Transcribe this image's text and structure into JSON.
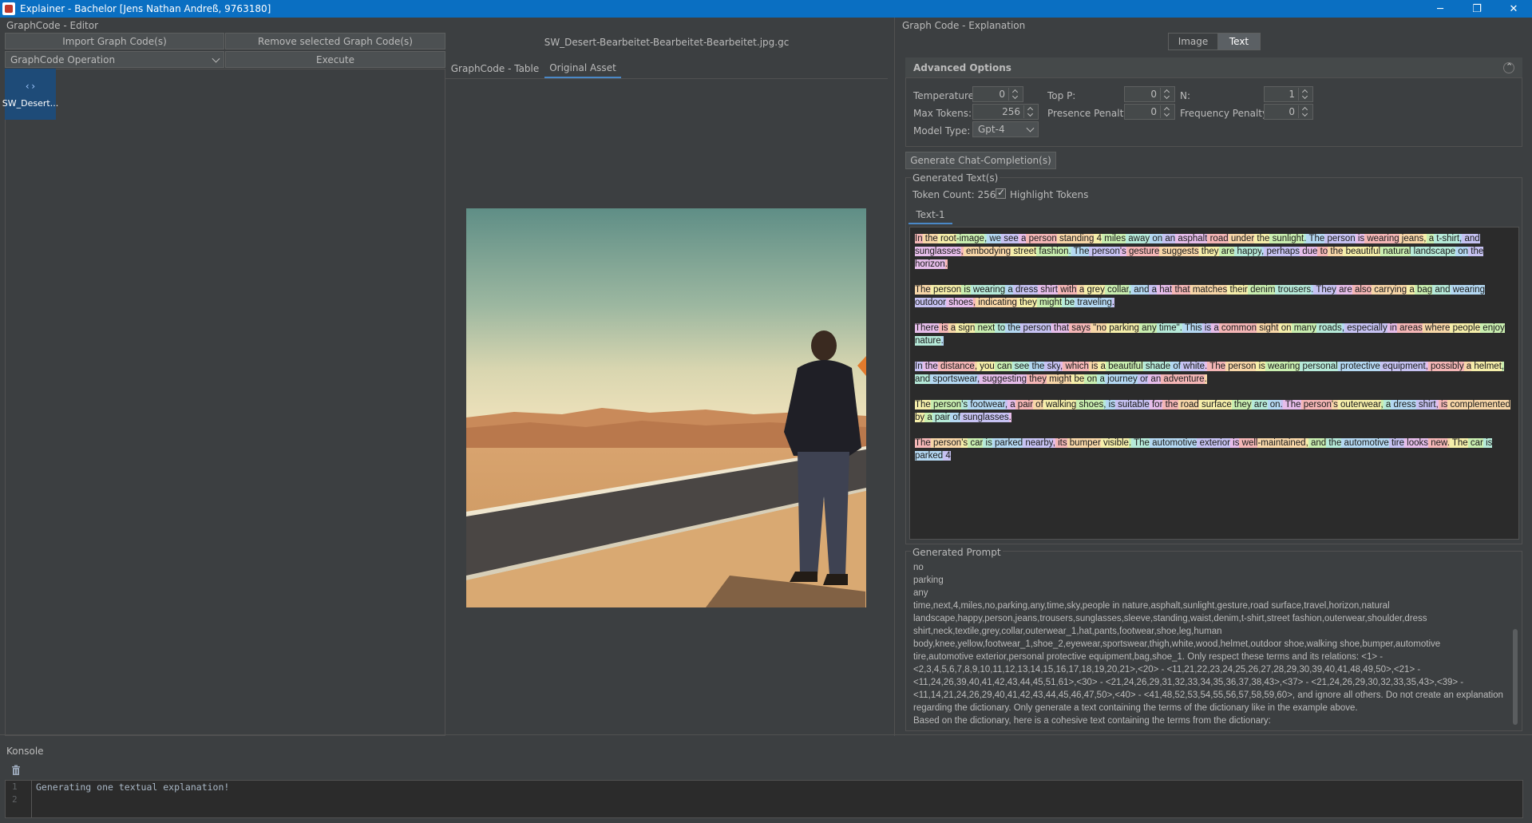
{
  "window": {
    "title": "Explainer - Bachelor [Jens Nathan Andreß, 9763180]"
  },
  "editor": {
    "panel_title": "GraphCode - Editor",
    "import_label": "Import Graph Code(s)",
    "remove_label": "Remove selected Graph Code(s)",
    "operation_selected": "GraphCode Operation",
    "execute_label": "Execute",
    "item_label": "SW_Desert..."
  },
  "viewer": {
    "filename": "SW_Desert-Bearbeitet-Bearbeitet-Bearbeitet.jpg.gc",
    "tabs": [
      "GraphCode - Table",
      "Original Asset"
    ],
    "active_tab": "Original Asset"
  },
  "explanation": {
    "panel_title": "Graph Code - Explanation",
    "mode_buttons": [
      "Image",
      "Text"
    ],
    "mode_selected": "Text",
    "advanced": {
      "title": "Advanced Options",
      "temperature_label": "Temperature:",
      "temperature": "0",
      "top_p_label": "Top P:",
      "top_p": "0",
      "n_label": "N:",
      "n": "1",
      "max_tokens_label": "Max Tokens:",
      "max_tokens": "256",
      "presence_label": "Presence Penalty:",
      "presence": "0",
      "frequency_label": "Frequency Penalty:",
      "frequency": "0",
      "model_label": "Model Type:",
      "model": "Gpt-4"
    },
    "generate_label": "Generate Chat-Completion(s)",
    "generated_texts_title": "Generated Text(s)",
    "token_count": "Token Count: 256",
    "highlight_label": "Highlight Tokens",
    "text_tab": "Text-1",
    "paragraphs": [
      [
        "In",
        " the",
        " root",
        "-image",
        ",",
        " we",
        " see",
        " a",
        " person",
        " standing",
        " 4",
        " miles",
        " away",
        " on",
        " an",
        " asphalt",
        " road",
        " under",
        " the",
        " sunlight",
        ".",
        " The",
        " person",
        " is",
        " wearing",
        " jeans",
        ",",
        " a",
        " t-shirt",
        ",",
        " and",
        " sunglasses",
        ",",
        " embodying",
        " street",
        " fashion",
        ".",
        " The",
        " person",
        "'s",
        " gesture",
        " suggests",
        " they",
        " are",
        " happy",
        ",",
        " perhaps",
        " due",
        " to",
        " the",
        " beautiful",
        " natural",
        " landscape",
        " on",
        " the",
        " horizon",
        "."
      ],
      [
        "The",
        " person",
        " is",
        " wearing",
        " a",
        " dress",
        " shirt",
        " with",
        " a",
        " grey",
        " collar",
        ",",
        " and",
        " a",
        " hat",
        " that",
        " matches",
        " their",
        " denim",
        " trousers",
        ".",
        " They",
        " are",
        " also",
        " carrying",
        " a",
        " bag",
        " and",
        " wearing",
        " outdoor",
        " shoes",
        ",",
        " indicating",
        " they",
        " might",
        " be",
        " traveling",
        "."
      ],
      [
        "There",
        " is",
        " a",
        " sign",
        " next",
        " to",
        " the",
        " person",
        " that",
        " says",
        " \"no",
        " parking",
        " any",
        " time\".",
        " This",
        " is",
        " a",
        " common",
        " sight",
        " on",
        " many",
        " roads",
        ",",
        " especially",
        " in",
        " areas",
        " where",
        " people",
        " enjoy",
        " nature",
        "."
      ],
      [
        "In",
        " the",
        " distance",
        ",",
        " you",
        " can",
        " see",
        " the",
        " sky",
        ",",
        " which",
        " is",
        " a",
        " beautiful",
        " shade",
        " of",
        " white",
        ".",
        " The",
        " person",
        " is",
        " wearing",
        " personal",
        " protective",
        " equipment",
        ",",
        " possibly",
        " a",
        " helmet",
        ",",
        " and",
        " sportswear",
        ",",
        " suggesting",
        " they",
        " might",
        " be",
        " on",
        " a",
        " journey",
        " or",
        " an",
        " adventure",
        "."
      ],
      [
        "The",
        " person",
        "'s",
        " footwear",
        ",",
        " a",
        " pair",
        " of",
        " walking",
        " shoes",
        ",",
        " is",
        " suitable",
        " for",
        " the",
        " road",
        " surface",
        " they",
        " are",
        " on",
        ".",
        " The",
        " person",
        "'s",
        " outerwear",
        ",",
        " a",
        " dress",
        " shirt",
        ",",
        " is",
        " complemented",
        " by",
        " a",
        " pair",
        " of",
        " sunglasses",
        "."
      ],
      [
        "The",
        " person",
        "'s",
        " car",
        " is",
        " parked",
        " nearby",
        ",",
        " its",
        " bumper",
        " visible",
        ".",
        " The",
        " automotive",
        " exterior",
        " is",
        " well",
        "-maintained",
        ",",
        " and",
        " the",
        " automotive",
        " tire",
        " looks",
        " new",
        ".",
        " The",
        " car",
        " is",
        " parked",
        " 4"
      ]
    ],
    "highlight_colors": [
      "#f4b6b6",
      "#f7d6a8",
      "#f5eeaa",
      "#c9eeb0",
      "#b6ead9",
      "#b4d8f2",
      "#c6c2f2",
      "#e6bdea"
    ],
    "generated_prompt_title": "Generated Prompt",
    "prompt_lines": [
      "no",
      "parking",
      "any",
      "time,next,4,miles,no,parking,any,time,sky,people in nature,asphalt,sunlight,gesture,road surface,travel,horizon,natural",
      "landscape,happy,person,jeans,trousers,sunglasses,sleeve,standing,waist,denim,t-shirt,street fashion,outerwear,shoulder,dress",
      "shirt,neck,textile,grey,collar,outerwear_1,hat,pants,footwear,shoe,leg,human",
      "body,knee,yellow,footwear_1,shoe_2,eyewear,sportswear,thigh,white,wood,helmet,outdoor shoe,walking shoe,bumper,automotive",
      "tire,automotive exterior,personal protective equipment,bag,shoe_1. Only respect these terms and its relations: <1> -",
      "<2,3,4,5,6,7,8,9,10,11,12,13,14,15,16,17,18,19,20,21>,<20> - <11,21,22,23,24,25,26,27,28,29,30,39,40,41,48,49,50>,<21> -",
      "<11,24,26,39,40,41,42,43,44,45,51,61>,<30> - <21,24,26,29,31,32,33,34,35,36,37,38,43>,<37> - <21,24,26,29,30,32,33,35,43>,<39> -",
      "<11,14,21,24,26,29,40,41,42,43,44,45,46,47,50>,<40> - <41,48,52,53,54,55,56,57,58,59,60>, and ignore all others. Do not create an explanation",
      "regarding the dictionary. Only generate a text containing the terms of the dictionary like in the example above.",
      "Based on the dictionary, here is a cohesive text containing the terms from the dictionary:"
    ]
  },
  "console": {
    "title": "Konsole",
    "line_numbers": [
      "1",
      "2"
    ],
    "lines": [
      "Generating one textual explanation!",
      ""
    ]
  }
}
